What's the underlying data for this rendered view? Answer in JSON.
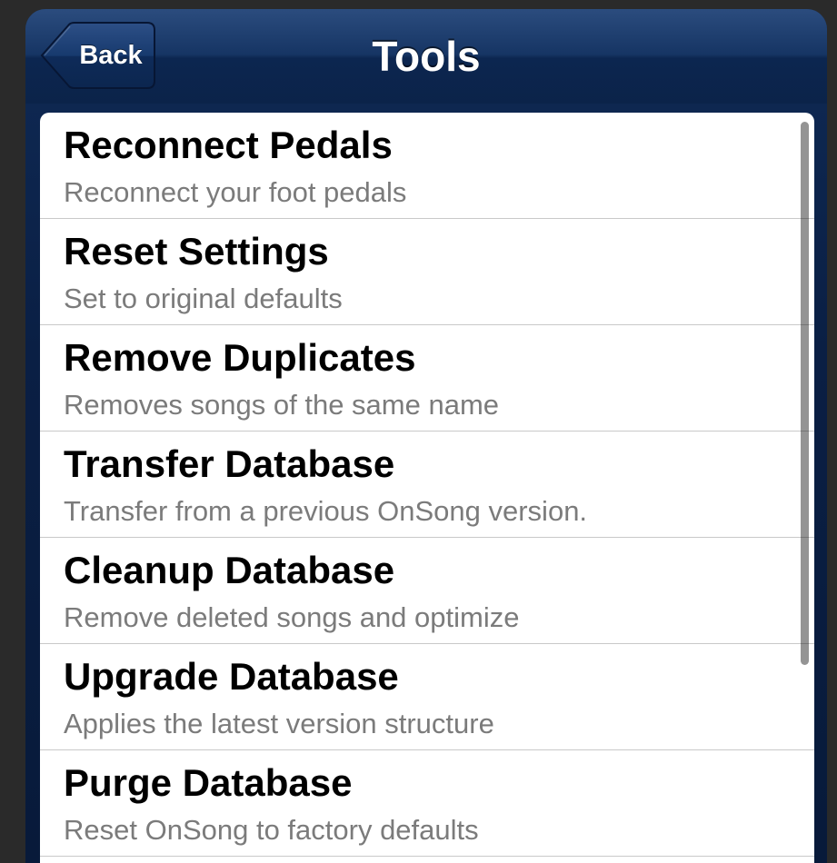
{
  "navbar": {
    "title": "Tools",
    "back_label": "Back"
  },
  "items": [
    {
      "title": "Reconnect Pedals",
      "subtitle": "Reconnect your foot pedals"
    },
    {
      "title": "Reset Settings",
      "subtitle": "Set to original defaults"
    },
    {
      "title": "Remove Duplicates",
      "subtitle": "Removes songs of the same name"
    },
    {
      "title": "Transfer Database",
      "subtitle": "Transfer from a previous OnSong version."
    },
    {
      "title": "Cleanup Database",
      "subtitle": "Remove deleted songs and optimize"
    },
    {
      "title": "Upgrade Database",
      "subtitle": "Applies the latest version structure"
    },
    {
      "title": "Purge Database",
      "subtitle": "Reset OnSong to factory defaults"
    }
  ],
  "colors": {
    "navbar": "#163564",
    "title_text": "#000000",
    "subtitle_text": "#7b7b7b",
    "separator": "#c9c9c9"
  },
  "icons": {
    "back": "back-arrow-button"
  }
}
